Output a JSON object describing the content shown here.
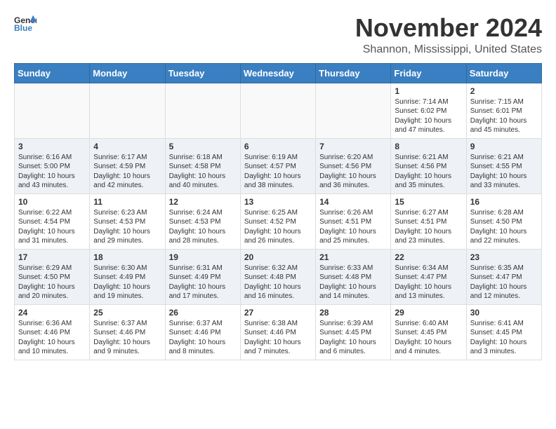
{
  "header": {
    "logo_line1": "General",
    "logo_line2": "Blue",
    "month": "November 2024",
    "location": "Shannon, Mississippi, United States"
  },
  "weekdays": [
    "Sunday",
    "Monday",
    "Tuesday",
    "Wednesday",
    "Thursday",
    "Friday",
    "Saturday"
  ],
  "weeks": [
    [
      {
        "day": "",
        "info": ""
      },
      {
        "day": "",
        "info": ""
      },
      {
        "day": "",
        "info": ""
      },
      {
        "day": "",
        "info": ""
      },
      {
        "day": "",
        "info": ""
      },
      {
        "day": "1",
        "info": "Sunrise: 7:14 AM\nSunset: 6:02 PM\nDaylight: 10 hours and 47 minutes."
      },
      {
        "day": "2",
        "info": "Sunrise: 7:15 AM\nSunset: 6:01 PM\nDaylight: 10 hours and 45 minutes."
      }
    ],
    [
      {
        "day": "3",
        "info": "Sunrise: 6:16 AM\nSunset: 5:00 PM\nDaylight: 10 hours and 43 minutes."
      },
      {
        "day": "4",
        "info": "Sunrise: 6:17 AM\nSunset: 4:59 PM\nDaylight: 10 hours and 42 minutes."
      },
      {
        "day": "5",
        "info": "Sunrise: 6:18 AM\nSunset: 4:58 PM\nDaylight: 10 hours and 40 minutes."
      },
      {
        "day": "6",
        "info": "Sunrise: 6:19 AM\nSunset: 4:57 PM\nDaylight: 10 hours and 38 minutes."
      },
      {
        "day": "7",
        "info": "Sunrise: 6:20 AM\nSunset: 4:56 PM\nDaylight: 10 hours and 36 minutes."
      },
      {
        "day": "8",
        "info": "Sunrise: 6:21 AM\nSunset: 4:56 PM\nDaylight: 10 hours and 35 minutes."
      },
      {
        "day": "9",
        "info": "Sunrise: 6:21 AM\nSunset: 4:55 PM\nDaylight: 10 hours and 33 minutes."
      }
    ],
    [
      {
        "day": "10",
        "info": "Sunrise: 6:22 AM\nSunset: 4:54 PM\nDaylight: 10 hours and 31 minutes."
      },
      {
        "day": "11",
        "info": "Sunrise: 6:23 AM\nSunset: 4:53 PM\nDaylight: 10 hours and 29 minutes."
      },
      {
        "day": "12",
        "info": "Sunrise: 6:24 AM\nSunset: 4:53 PM\nDaylight: 10 hours and 28 minutes."
      },
      {
        "day": "13",
        "info": "Sunrise: 6:25 AM\nSunset: 4:52 PM\nDaylight: 10 hours and 26 minutes."
      },
      {
        "day": "14",
        "info": "Sunrise: 6:26 AM\nSunset: 4:51 PM\nDaylight: 10 hours and 25 minutes."
      },
      {
        "day": "15",
        "info": "Sunrise: 6:27 AM\nSunset: 4:51 PM\nDaylight: 10 hours and 23 minutes."
      },
      {
        "day": "16",
        "info": "Sunrise: 6:28 AM\nSunset: 4:50 PM\nDaylight: 10 hours and 22 minutes."
      }
    ],
    [
      {
        "day": "17",
        "info": "Sunrise: 6:29 AM\nSunset: 4:50 PM\nDaylight: 10 hours and 20 minutes."
      },
      {
        "day": "18",
        "info": "Sunrise: 6:30 AM\nSunset: 4:49 PM\nDaylight: 10 hours and 19 minutes."
      },
      {
        "day": "19",
        "info": "Sunrise: 6:31 AM\nSunset: 4:49 PM\nDaylight: 10 hours and 17 minutes."
      },
      {
        "day": "20",
        "info": "Sunrise: 6:32 AM\nSunset: 4:48 PM\nDaylight: 10 hours and 16 minutes."
      },
      {
        "day": "21",
        "info": "Sunrise: 6:33 AM\nSunset: 4:48 PM\nDaylight: 10 hours and 14 minutes."
      },
      {
        "day": "22",
        "info": "Sunrise: 6:34 AM\nSunset: 4:47 PM\nDaylight: 10 hours and 13 minutes."
      },
      {
        "day": "23",
        "info": "Sunrise: 6:35 AM\nSunset: 4:47 PM\nDaylight: 10 hours and 12 minutes."
      }
    ],
    [
      {
        "day": "24",
        "info": "Sunrise: 6:36 AM\nSunset: 4:46 PM\nDaylight: 10 hours and 10 minutes."
      },
      {
        "day": "25",
        "info": "Sunrise: 6:37 AM\nSunset: 4:46 PM\nDaylight: 10 hours and 9 minutes."
      },
      {
        "day": "26",
        "info": "Sunrise: 6:37 AM\nSunset: 4:46 PM\nDaylight: 10 hours and 8 minutes."
      },
      {
        "day": "27",
        "info": "Sunrise: 6:38 AM\nSunset: 4:46 PM\nDaylight: 10 hours and 7 minutes."
      },
      {
        "day": "28",
        "info": "Sunrise: 6:39 AM\nSunset: 4:45 PM\nDaylight: 10 hours and 6 minutes."
      },
      {
        "day": "29",
        "info": "Sunrise: 6:40 AM\nSunset: 4:45 PM\nDaylight: 10 hours and 4 minutes."
      },
      {
        "day": "30",
        "info": "Sunrise: 6:41 AM\nSunset: 4:45 PM\nDaylight: 10 hours and 3 minutes."
      }
    ]
  ]
}
